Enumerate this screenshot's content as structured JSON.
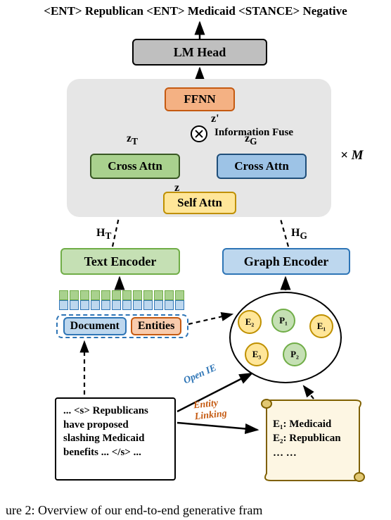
{
  "output_sequence": {
    "tag_ent1": "<ENT>",
    "entity1": "Republican",
    "tag_ent2": "<ENT>",
    "entity2": "Medicaid",
    "tag_stance": "<STANCE>",
    "stance": "Negative"
  },
  "lm_head": "LM Head",
  "decoder": {
    "ffnn": "FFNN",
    "z_prime": "z'",
    "info_fuse": "Information Fuse",
    "z_T": "z",
    "z_T_sub": "T",
    "z_G": "z",
    "z_G_sub": "G",
    "cross_attn_left": "Cross Attn",
    "cross_attn_right": "Cross Attn",
    "z": "z",
    "self_attn": "Self Attn",
    "repeat": "× M"
  },
  "H_T": "H",
  "H_T_sub": "T",
  "H_G": "H",
  "H_G_sub": "G",
  "text_encoder": "Text Encoder",
  "graph_encoder": "Graph Encoder",
  "doc_entities": {
    "document": "Document",
    "entities": "Entities"
  },
  "graph_nodes": {
    "e1": "E₁",
    "e2": "E₂",
    "e3": "E₃",
    "p1": "P₁",
    "p2": "P₂"
  },
  "open_ie": "Open IE",
  "entity_linking": "Entity\nLinking",
  "source_document": "... <s> Republicans have proposed slashing Medicaid benefits ... </s> ...",
  "entity_list": {
    "row1": "E₁: Medicaid",
    "row2": "E₂: Republican",
    "row3": "… …"
  },
  "caption": "ure 2: Overview of our end-to-end generative fram"
}
